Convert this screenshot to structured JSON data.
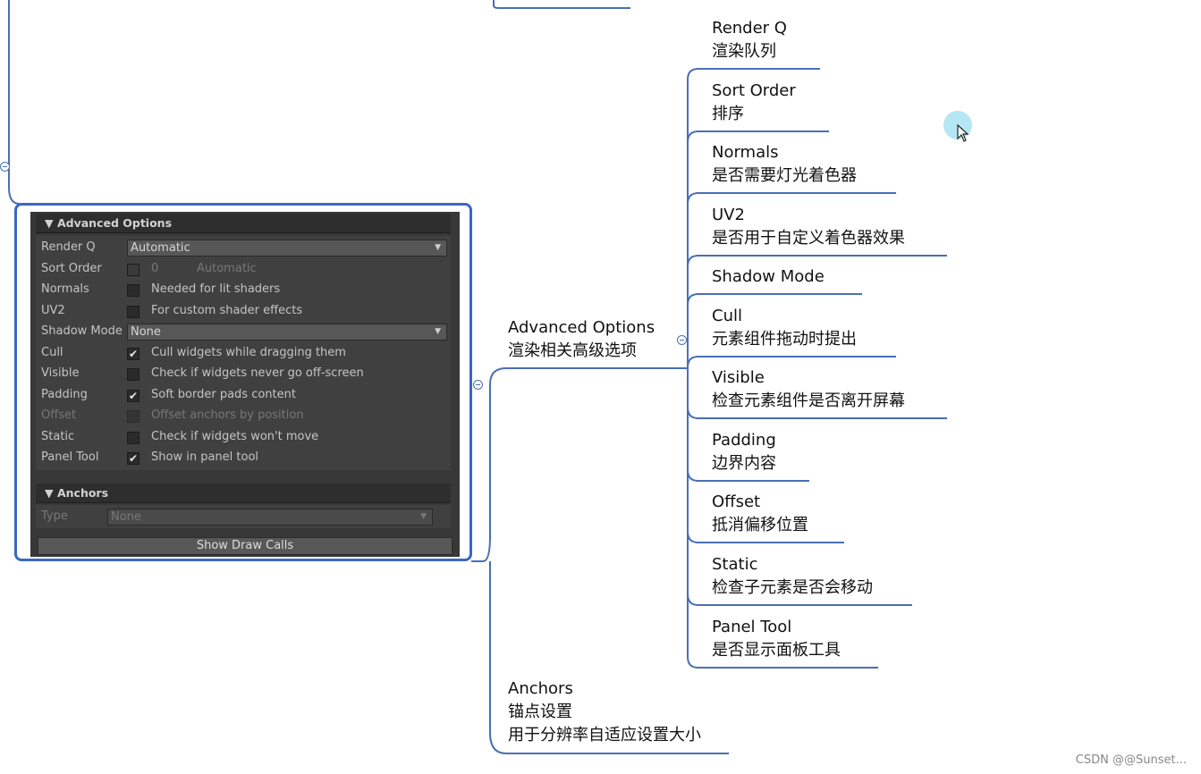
{
  "root_branch": {
    "title": "Advanced Options",
    "subtitle": "渲染相关高级选项"
  },
  "children": [
    {
      "title": "Render Q",
      "subtitle": "渲染队列"
    },
    {
      "title": "Sort Order",
      "subtitle": "排序"
    },
    {
      "title": "Normals",
      "subtitle": "是否需要灯光着色器"
    },
    {
      "title": "UV2",
      "subtitle": "是否用于自定义着色器效果"
    },
    {
      "title": "Shadow Mode",
      "subtitle": ""
    },
    {
      "title": "Cull",
      "subtitle": "元素组件拖动时提出"
    },
    {
      "title": "Visible",
      "subtitle": "检查元素组件是否离开屏幕"
    },
    {
      "title": "Padding",
      "subtitle": "边界内容"
    },
    {
      "title": "Offset",
      "subtitle": "抵消偏移位置"
    },
    {
      "title": "Static",
      "subtitle": "检查子元素是否会移动"
    },
    {
      "title": "Panel Tool",
      "subtitle": "是否显示面板工具"
    }
  ],
  "anchors_node": {
    "title": "Anchors",
    "line1": "锚点设置",
    "line2": "用于分辨率自适应设置大小"
  },
  "inspector": {
    "header_advanced": "▼ Advanced Options",
    "rows": [
      {
        "label": "Render Q",
        "kind": "dropdown",
        "value": "Automatic"
      },
      {
        "label": "Sort Order",
        "kind": "number",
        "value": "0",
        "extra": "Automatic"
      },
      {
        "label": "Normals",
        "kind": "check",
        "checked": false,
        "text": "Needed for lit shaders"
      },
      {
        "label": "UV2",
        "kind": "check",
        "checked": false,
        "text": "For custom shader effects"
      },
      {
        "label": "Shadow Mode",
        "kind": "dropdown",
        "value": "None"
      },
      {
        "label": "Cull",
        "kind": "check",
        "checked": true,
        "text": "Cull widgets while dragging them"
      },
      {
        "label": "Visible",
        "kind": "check",
        "checked": false,
        "text": "Check if widgets never go off-screen"
      },
      {
        "label": "Padding",
        "kind": "check",
        "checked": true,
        "text": "Soft border pads content"
      },
      {
        "label": "Offset",
        "kind": "check",
        "checked": false,
        "text": "Offset anchors by position",
        "disabled": true
      },
      {
        "label": "Static",
        "kind": "check",
        "checked": false,
        "text": "Check if widgets won't move"
      },
      {
        "label": "Panel Tool",
        "kind": "check",
        "checked": true,
        "text": "Show in panel tool"
      }
    ],
    "header_anchors": "▼ Anchors",
    "type_label": "Type",
    "type_value": "None",
    "button_label": "Show Draw Calls",
    "check_glyph": "✔",
    "dropdown_arrow": "▼"
  },
  "watermark": "CSDN @@Sunset...",
  "colors": {
    "branch_line": "#4a6fb5",
    "panel_border": "#3c67c2",
    "inspector_bg": "#383838"
  }
}
